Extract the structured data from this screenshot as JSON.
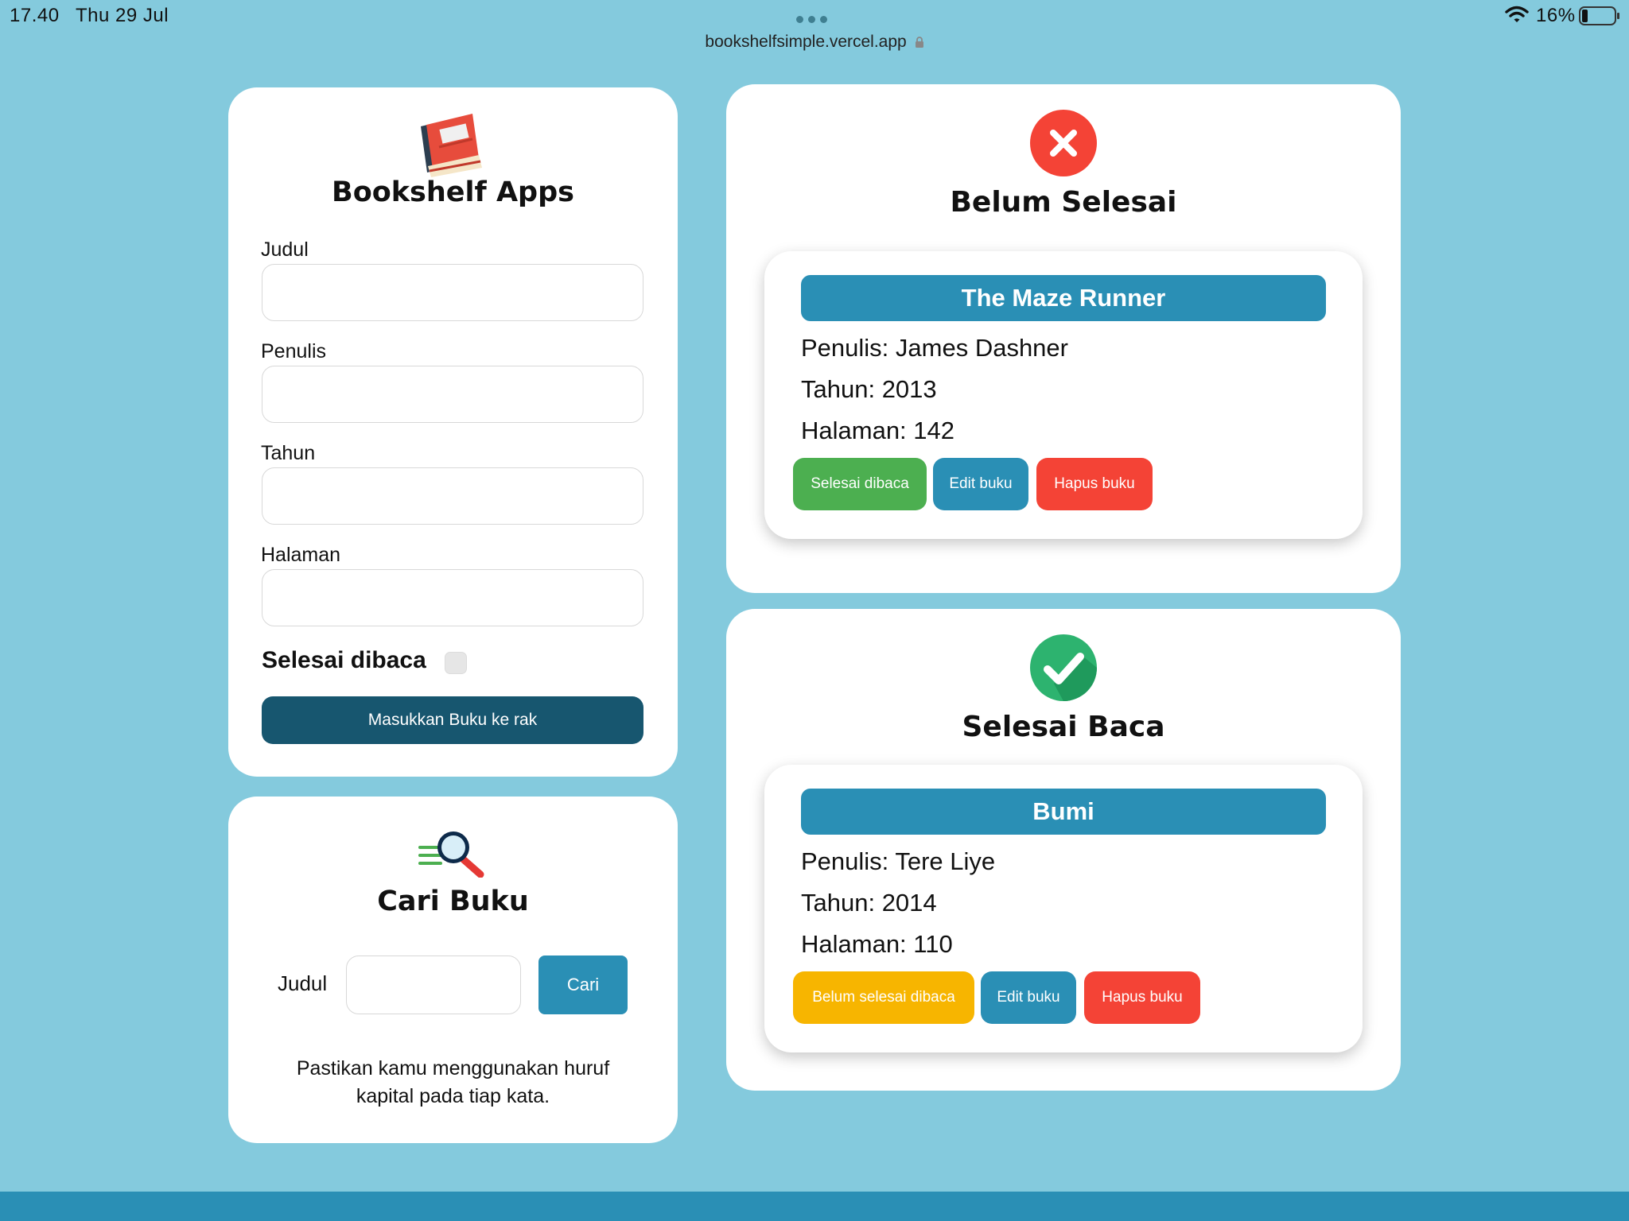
{
  "status_bar": {
    "time": "17.40",
    "date": "Thu 29 Jul",
    "url": "bookshelfsimple.vercel.app",
    "battery": "16%"
  },
  "add_form": {
    "title": "Bookshelf Apps",
    "fields": [
      {
        "label": "Judul",
        "value": ""
      },
      {
        "label": "Penulis",
        "value": ""
      },
      {
        "label": "Tahun",
        "value": ""
      },
      {
        "label": "Halaman",
        "value": ""
      }
    ],
    "checkbox_label": "Selesai dibaca",
    "checkbox_checked": false,
    "submit_label": "Masukkan Buku ke rak"
  },
  "search": {
    "title": "Cari Buku",
    "label": "Judul",
    "value": "",
    "button_label": "Cari",
    "hint_line1": "Pastikan kamu menggunakan huruf",
    "hint_line2": "kapital pada tiap kata."
  },
  "unfinished": {
    "title": "Belum Selesai",
    "books": [
      {
        "title": "The Maze Runner",
        "author": "Penulis: James Dashner",
        "year": "Tahun: 2013",
        "pages": "Halaman: 142",
        "toggle_label": "Selesai dibaca",
        "edit_label": "Edit buku",
        "delete_label": "Hapus buku"
      }
    ]
  },
  "finished": {
    "title": "Selesai Baca",
    "books": [
      {
        "title": "Bumi",
        "author": "Penulis: Tere Liye",
        "year": "Tahun: 2014",
        "pages": "Halaman: 110",
        "toggle_label": "Belum selesai dibaca",
        "edit_label": "Edit buku",
        "delete_label": "Hapus buku"
      }
    ]
  },
  "colors": {
    "background": "#84cadd",
    "primary": "#2a8fb5",
    "dark_button": "#17566f",
    "green": "#4caf50",
    "red": "#f44336",
    "yellow": "#f7b500"
  },
  "icons": [
    "book-icon",
    "magnifier-icon",
    "close-circle-icon",
    "check-circle-icon",
    "wifi-icon",
    "battery-icon"
  ]
}
